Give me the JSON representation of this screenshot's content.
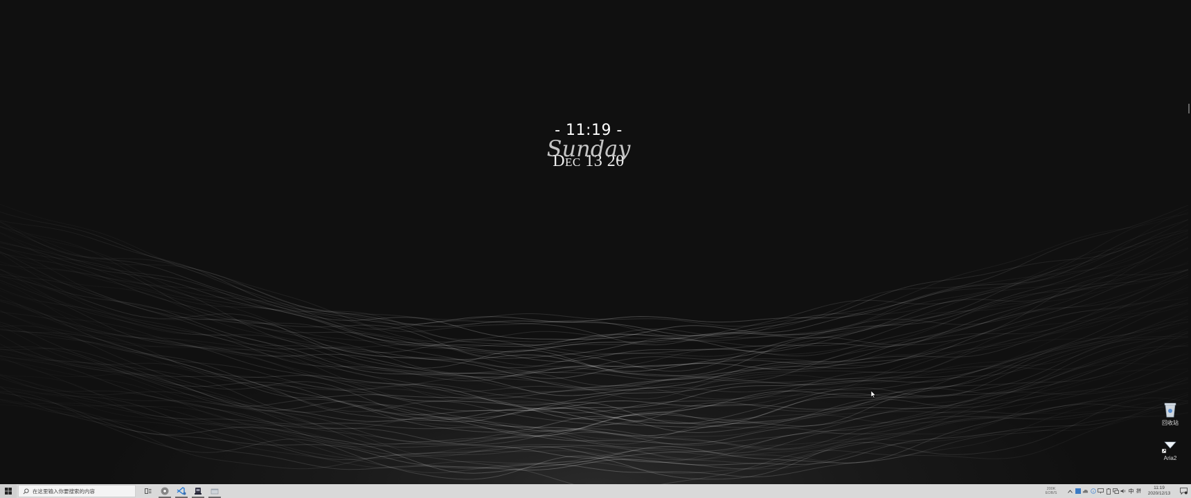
{
  "clock": {
    "time": "- 11:19 -",
    "day": "Sunday",
    "date": "Dec 13 20"
  },
  "desktop_icons": [
    {
      "label": "回收站",
      "icon": "recycle-bin-icon"
    },
    {
      "label": "Aria2",
      "icon": "aria2-icon"
    }
  ],
  "taskbar": {
    "search_placeholder": "在这里输入你要搜索的内容",
    "apps": [
      {
        "name": "chrome-icon"
      },
      {
        "name": "vscode-icon"
      },
      {
        "name": "app-icon"
      },
      {
        "name": "window-icon"
      }
    ],
    "net_speed": {
      "up": "200K",
      "down": "EOB/S"
    },
    "ime": "中",
    "ime_mode": "拼",
    "clock_time": "11:19",
    "clock_date": "2020/12/13"
  },
  "colors": {
    "taskbar_bg": "#d9d9d9",
    "desktop_bg": "#0f0f0f"
  }
}
